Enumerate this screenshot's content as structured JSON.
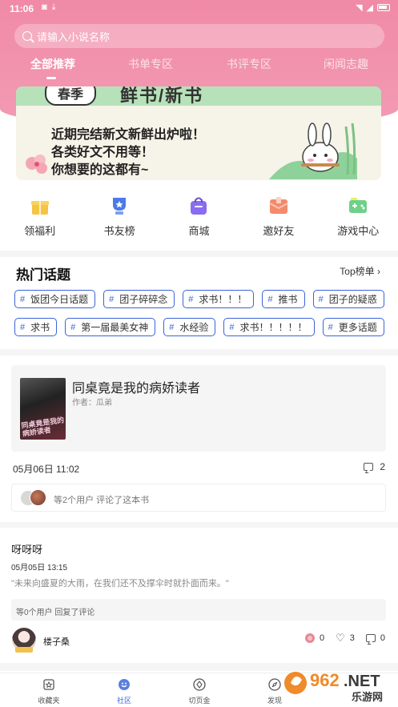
{
  "status": {
    "time": "11:06"
  },
  "search": {
    "placeholder": "请输入小说名称"
  },
  "tabs": [
    {
      "label": "全部推荐"
    },
    {
      "label": "书单专区"
    },
    {
      "label": "书评专区"
    },
    {
      "label": "闲闻志趣"
    }
  ],
  "banner": {
    "tag": "春季",
    "headline": "鲜书/新书",
    "lines": [
      "近期完结新文新鲜出炉啦！",
      "各类好文不用等！",
      "你想要的这都有~"
    ]
  },
  "quick_links": [
    {
      "label": "领福利",
      "icon": "gift-icon",
      "color": "#f5c445"
    },
    {
      "label": "书友榜",
      "icon": "trophy-icon",
      "color": "#4a7be6"
    },
    {
      "label": "商城",
      "icon": "shopping-bag-icon",
      "color": "#8a6cf0"
    },
    {
      "label": "邀好友",
      "icon": "envelope-icon",
      "color": "#f38a6b"
    },
    {
      "label": "游戏中心",
      "icon": "gamepad-icon",
      "color": "#6fd08a"
    }
  ],
  "hot_topics": {
    "title": "热门话题",
    "more_label": "Top榜单",
    "row1": [
      "饭团今日话题",
      "团子碎碎念",
      "求书！！！",
      "推书",
      "团子的疑惑"
    ],
    "row2": [
      "求书",
      "第一届最美女神",
      "水经验",
      "求书！！！！！",
      "更多话题"
    ]
  },
  "book_card": {
    "title": "同桌竟是我的病娇读者",
    "author": "作者：瓜弟",
    "cover_text": "同桌竟是我的病娇读者",
    "date": "05月06日 11:02",
    "comments": "2",
    "reviewers_text": "等2个用户 评论了这本书"
  },
  "post": {
    "title": "呀呀呀",
    "date": "05月05日 13:15",
    "body": "\"未来向盛夏的大雨，在我们还不及撑伞时就扑面而来。\"",
    "reply_text": "等0个用户 回复了评论",
    "author": "楼子桑",
    "flowers": "0",
    "likes": "3",
    "comments": "0"
  },
  "bottom_nav": [
    {
      "label": "收藏夹",
      "icon": "bookshelf-icon"
    },
    {
      "label": "社区",
      "icon": "community-icon"
    },
    {
      "label": "切页金",
      "icon": "coin-icon"
    },
    {
      "label": "发现",
      "icon": "compass-icon"
    }
  ],
  "watermark": {
    "text": "962.NET",
    "sub": "乐游网"
  }
}
